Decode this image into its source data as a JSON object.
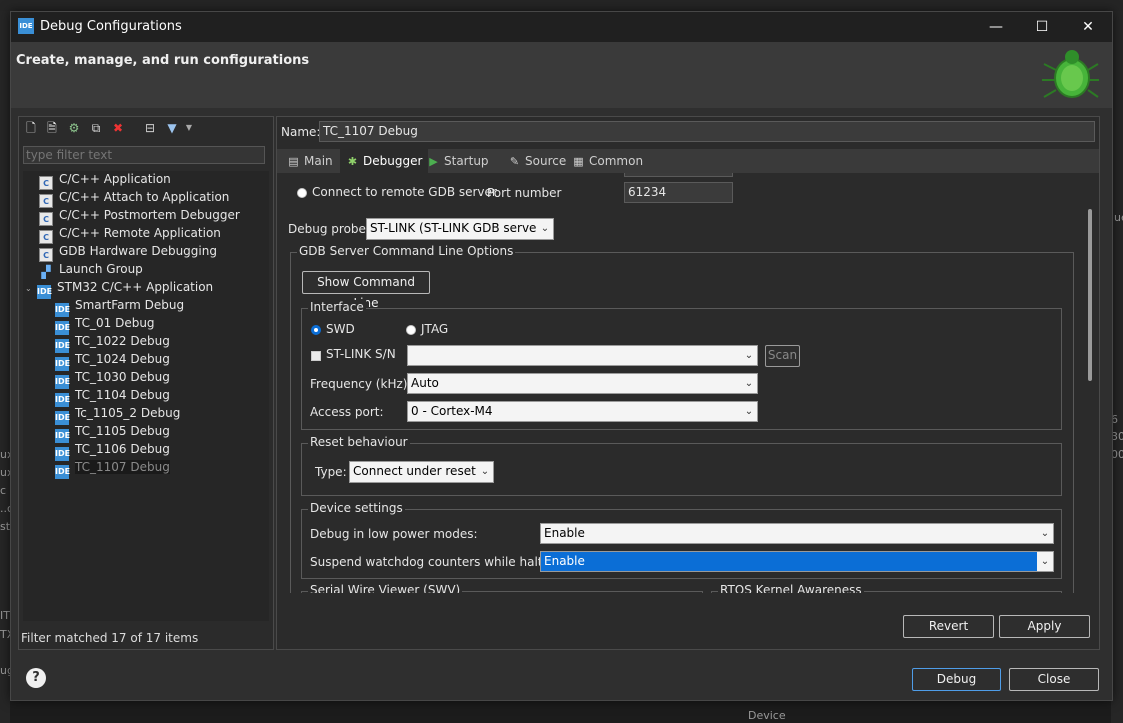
{
  "background": {
    "left_fragments": [
      "ux",
      "ux",
      "c",
      "..c",
      "st",
      "IT",
      "TX",
      "ug"
    ],
    "right_fragments": [
      "lue",
      "6",
      "30",
      "00"
    ],
    "bottom_item": "Device"
  },
  "window": {
    "title": "Debug Configurations",
    "title_icon": "IDE",
    "controls": {
      "minimize": "—",
      "maximize": "☐",
      "close": "✕"
    }
  },
  "banner": {
    "title": "Create, manage, and run configurations"
  },
  "left_panel": {
    "filter_placeholder": "type filter text",
    "tree": [
      {
        "label": "C/C++ Application",
        "icon": "C"
      },
      {
        "label": "C/C++ Attach to Application",
        "icon": "C"
      },
      {
        "label": "C/C++ Postmortem Debugger",
        "icon": "C"
      },
      {
        "label": "C/C++ Remote Application",
        "icon": "C"
      },
      {
        "label": "GDB Hardware Debugging",
        "icon": "C"
      },
      {
        "label": "Launch Group",
        "icon": "launch"
      },
      {
        "label": "STM32 C/C++ Application",
        "icon": "IDE"
      },
      {
        "label": "SmartFarm Debug",
        "icon": "IDE"
      },
      {
        "label": "TC_01 Debug",
        "icon": "IDE"
      },
      {
        "label": "TC_1022 Debug",
        "icon": "IDE"
      },
      {
        "label": "TC_1024 Debug",
        "icon": "IDE"
      },
      {
        "label": "TC_1030 Debug",
        "icon": "IDE"
      },
      {
        "label": "TC_1104 Debug",
        "icon": "IDE"
      },
      {
        "label": "Tc_1105_2 Debug",
        "icon": "IDE"
      },
      {
        "label": "TC_1105 Debug",
        "icon": "IDE"
      },
      {
        "label": "TC_1106 Debug",
        "icon": "IDE"
      },
      {
        "label": "TC_1107 Debug",
        "icon": "IDE"
      }
    ],
    "status": "Filter matched 17 of 17 items"
  },
  "right_panel": {
    "name_label": "Name:",
    "name_value": "TC_1107 Debug",
    "tabs": [
      {
        "label": "Main",
        "icon": "▤"
      },
      {
        "label": "Debugger",
        "icon": "✱"
      },
      {
        "label": "Startup",
        "icon": "▶"
      },
      {
        "label": "Source",
        "icon": "✎"
      },
      {
        "label": "Common",
        "icon": "▦"
      }
    ],
    "remote_gdb_label": "Connect to remote GDB server",
    "port_label": "Port number",
    "port_value": "61234",
    "debug_probe_label": "Debug probe",
    "debug_probe_value": "ST-LINK (ST-LINK GDB server)",
    "gdb_group_title": "GDB Server Command Line Options",
    "show_cmd_button": "Show Command Line",
    "interface": {
      "title": "Interface",
      "swd": "SWD",
      "jtag": "JTAG",
      "stlink_sn": "ST-LINK S/N",
      "stlink_sn_value": "",
      "scan": "Scan",
      "frequency_label": "Frequency (kHz):",
      "frequency_value": "Auto",
      "access_port_label": "Access port:",
      "access_port_value": "0 - Cortex-M4"
    },
    "reset": {
      "title": "Reset behaviour",
      "type_label": "Type:",
      "type_value": "Connect under reset"
    },
    "device": {
      "title": "Device settings",
      "low_power_label": "Debug in low power modes:",
      "low_power_value": "Enable",
      "watchdog_label": "Suspend watchdog counters while halted:",
      "watchdog_value": "Enable"
    },
    "swv_title": "Serial Wire Viewer (SWV)",
    "rtos_title": "RTOS Kernel Awareness",
    "revert_button": "Revert",
    "apply_button": "Apply"
  },
  "footer": {
    "help": "?",
    "debug_button": "Debug",
    "close_button": "Close"
  },
  "colors": {
    "accent": "#0b6ed6",
    "ide_icon": "#3a8fd6",
    "window_bg": "#2f2f2f",
    "panel_bg": "#2b2b2b"
  }
}
